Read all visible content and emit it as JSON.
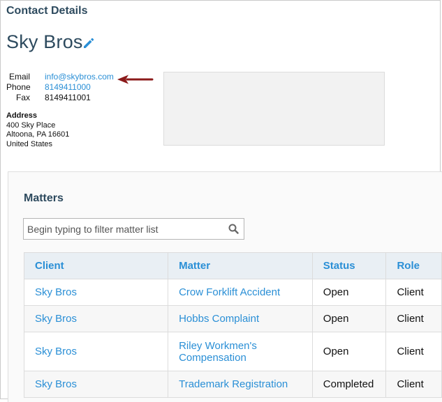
{
  "section_title": "Contact Details",
  "contact": {
    "name": "Sky Bros",
    "email_label": "Email",
    "email": "info@skybros.com",
    "phone_label": "Phone",
    "phone": "8149411000",
    "fax_label": "Fax",
    "fax": "8149411001",
    "address_label": "Address",
    "address_lines": [
      "400 Sky Place",
      "Altoona, PA 16601",
      "United States"
    ]
  },
  "matters": {
    "title": "Matters",
    "filter_placeholder": "Begin typing to filter matter list",
    "columns": [
      "Client",
      "Matter",
      "Status",
      "Role"
    ],
    "rows": [
      {
        "client": "Sky Bros",
        "matter": "Crow Forklift Accident",
        "status": "Open",
        "role": "Client"
      },
      {
        "client": "Sky Bros",
        "matter": "Hobbs Complaint",
        "status": "Open",
        "role": "Client"
      },
      {
        "client": "Sky Bros",
        "matter": "Riley Workmen's Compensation",
        "status": "Open",
        "role": "Client"
      },
      {
        "client": "Sky Bros",
        "matter": "Trademark Registration",
        "status": "Completed",
        "role": "Client"
      }
    ]
  },
  "icons": {
    "edit": "pencil-icon",
    "search": "magnifier-icon",
    "annotation": "arrow-icon"
  },
  "colors": {
    "heading": "#2d4a5e",
    "link": "#2a8fd6",
    "annotation_arrow": "#8b1a1a"
  }
}
